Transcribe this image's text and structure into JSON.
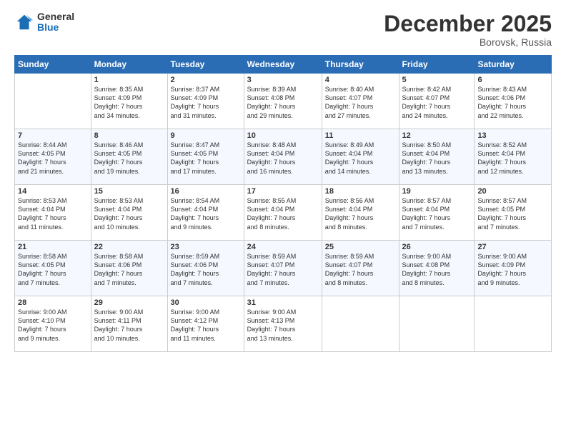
{
  "logo": {
    "general": "General",
    "blue": "Blue"
  },
  "header": {
    "month": "December 2025",
    "location": "Borovsk, Russia"
  },
  "days_of_week": [
    "Sunday",
    "Monday",
    "Tuesday",
    "Wednesday",
    "Thursday",
    "Friday",
    "Saturday"
  ],
  "weeks": [
    [
      {
        "num": "",
        "info": ""
      },
      {
        "num": "1",
        "info": "Sunrise: 8:35 AM\nSunset: 4:09 PM\nDaylight: 7 hours\nand 34 minutes."
      },
      {
        "num": "2",
        "info": "Sunrise: 8:37 AM\nSunset: 4:09 PM\nDaylight: 7 hours\nand 31 minutes."
      },
      {
        "num": "3",
        "info": "Sunrise: 8:39 AM\nSunset: 4:08 PM\nDaylight: 7 hours\nand 29 minutes."
      },
      {
        "num": "4",
        "info": "Sunrise: 8:40 AM\nSunset: 4:07 PM\nDaylight: 7 hours\nand 27 minutes."
      },
      {
        "num": "5",
        "info": "Sunrise: 8:42 AM\nSunset: 4:07 PM\nDaylight: 7 hours\nand 24 minutes."
      },
      {
        "num": "6",
        "info": "Sunrise: 8:43 AM\nSunset: 4:06 PM\nDaylight: 7 hours\nand 22 minutes."
      }
    ],
    [
      {
        "num": "7",
        "info": "Sunrise: 8:44 AM\nSunset: 4:05 PM\nDaylight: 7 hours\nand 21 minutes."
      },
      {
        "num": "8",
        "info": "Sunrise: 8:46 AM\nSunset: 4:05 PM\nDaylight: 7 hours\nand 19 minutes."
      },
      {
        "num": "9",
        "info": "Sunrise: 8:47 AM\nSunset: 4:05 PM\nDaylight: 7 hours\nand 17 minutes."
      },
      {
        "num": "10",
        "info": "Sunrise: 8:48 AM\nSunset: 4:04 PM\nDaylight: 7 hours\nand 16 minutes."
      },
      {
        "num": "11",
        "info": "Sunrise: 8:49 AM\nSunset: 4:04 PM\nDaylight: 7 hours\nand 14 minutes."
      },
      {
        "num": "12",
        "info": "Sunrise: 8:50 AM\nSunset: 4:04 PM\nDaylight: 7 hours\nand 13 minutes."
      },
      {
        "num": "13",
        "info": "Sunrise: 8:52 AM\nSunset: 4:04 PM\nDaylight: 7 hours\nand 12 minutes."
      }
    ],
    [
      {
        "num": "14",
        "info": "Sunrise: 8:53 AM\nSunset: 4:04 PM\nDaylight: 7 hours\nand 11 minutes."
      },
      {
        "num": "15",
        "info": "Sunrise: 8:53 AM\nSunset: 4:04 PM\nDaylight: 7 hours\nand 10 minutes."
      },
      {
        "num": "16",
        "info": "Sunrise: 8:54 AM\nSunset: 4:04 PM\nDaylight: 7 hours\nand 9 minutes."
      },
      {
        "num": "17",
        "info": "Sunrise: 8:55 AM\nSunset: 4:04 PM\nDaylight: 7 hours\nand 8 minutes."
      },
      {
        "num": "18",
        "info": "Sunrise: 8:56 AM\nSunset: 4:04 PM\nDaylight: 7 hours\nand 8 minutes."
      },
      {
        "num": "19",
        "info": "Sunrise: 8:57 AM\nSunset: 4:04 PM\nDaylight: 7 hours\nand 7 minutes."
      },
      {
        "num": "20",
        "info": "Sunrise: 8:57 AM\nSunset: 4:05 PM\nDaylight: 7 hours\nand 7 minutes."
      }
    ],
    [
      {
        "num": "21",
        "info": "Sunrise: 8:58 AM\nSunset: 4:05 PM\nDaylight: 7 hours\nand 7 minutes."
      },
      {
        "num": "22",
        "info": "Sunrise: 8:58 AM\nSunset: 4:06 PM\nDaylight: 7 hours\nand 7 minutes."
      },
      {
        "num": "23",
        "info": "Sunrise: 8:59 AM\nSunset: 4:06 PM\nDaylight: 7 hours\nand 7 minutes."
      },
      {
        "num": "24",
        "info": "Sunrise: 8:59 AM\nSunset: 4:07 PM\nDaylight: 7 hours\nand 7 minutes."
      },
      {
        "num": "25",
        "info": "Sunrise: 8:59 AM\nSunset: 4:07 PM\nDaylight: 7 hours\nand 8 minutes."
      },
      {
        "num": "26",
        "info": "Sunrise: 9:00 AM\nSunset: 4:08 PM\nDaylight: 7 hours\nand 8 minutes."
      },
      {
        "num": "27",
        "info": "Sunrise: 9:00 AM\nSunset: 4:09 PM\nDaylight: 7 hours\nand 9 minutes."
      }
    ],
    [
      {
        "num": "28",
        "info": "Sunrise: 9:00 AM\nSunset: 4:10 PM\nDaylight: 7 hours\nand 9 minutes."
      },
      {
        "num": "29",
        "info": "Sunrise: 9:00 AM\nSunset: 4:11 PM\nDaylight: 7 hours\nand 10 minutes."
      },
      {
        "num": "30",
        "info": "Sunrise: 9:00 AM\nSunset: 4:12 PM\nDaylight: 7 hours\nand 11 minutes."
      },
      {
        "num": "31",
        "info": "Sunrise: 9:00 AM\nSunset: 4:13 PM\nDaylight: 7 hours\nand 13 minutes."
      },
      {
        "num": "",
        "info": ""
      },
      {
        "num": "",
        "info": ""
      },
      {
        "num": "",
        "info": ""
      }
    ]
  ]
}
